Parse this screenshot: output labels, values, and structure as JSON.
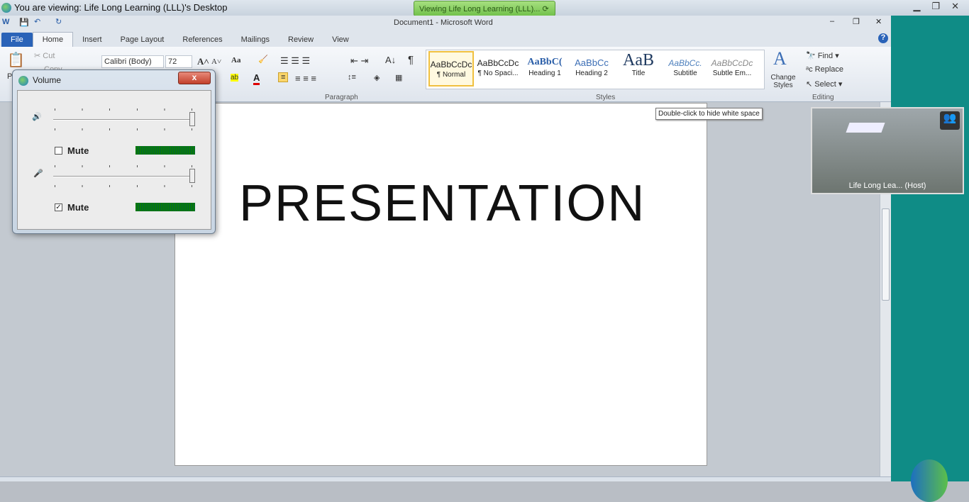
{
  "viewer": {
    "title": "You are viewing: Life Long Learning (LLL)'s Desktop",
    "banner": "Viewing Life Long Learning (LLL)..."
  },
  "word": {
    "title": "Document1 - Microsoft Word",
    "tabs": [
      "File",
      "Home",
      "Insert",
      "Page Layout",
      "References",
      "Mailings",
      "Review",
      "View"
    ],
    "clipboard": {
      "cut": "Cut",
      "copy": "Copy",
      "paste": "P"
    },
    "font": {
      "name": "Calibri (Body)",
      "size": "72",
      "change_case": "Aa"
    },
    "paragraph_label": "Paragraph",
    "styles_label": "Styles",
    "styles": [
      {
        "sample": "AaBbCcDc",
        "name": "¶ Normal"
      },
      {
        "sample": "AaBbCcDc",
        "name": "¶ No Spaci..."
      },
      {
        "sample": "AaBbC(",
        "name": "Heading 1"
      },
      {
        "sample": "AaBbCc",
        "name": "Heading 2"
      },
      {
        "sample": "AaB",
        "name": "Title"
      },
      {
        "sample": "AaBbCc.",
        "name": "Subtitle"
      },
      {
        "sample": "AaBbCcDc",
        "name": "Subtle Em..."
      }
    ],
    "change_styles": "Change Styles",
    "editing": {
      "label": "Editing",
      "find": "Find",
      "replace": "Replace",
      "select": "Select"
    },
    "document_text": "PRESENTATION",
    "tooltip": "Double-click to hide white space"
  },
  "webcam": {
    "label": "Life Long Lea... (Host)"
  },
  "volume": {
    "title": "Volume",
    "close": "x",
    "rows": [
      {
        "mute_label": "Mute",
        "muted": false,
        "level": 100
      },
      {
        "mute_label": "Mute",
        "muted": true,
        "level": 100
      }
    ]
  },
  "colors": {
    "teal": "#0f8c86",
    "file_tab": "#2a63b8",
    "banner": "#8fd366"
  }
}
